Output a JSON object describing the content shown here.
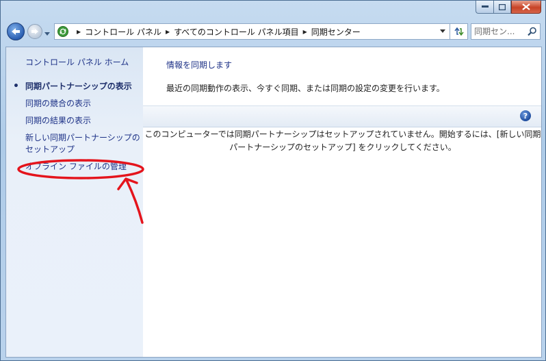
{
  "address": {
    "crumbs": [
      "コントロール パネル",
      "すべてのコントロール パネル項目",
      "同期センター"
    ],
    "search_placeholder": "同期セン..."
  },
  "sidebar": {
    "home": "コントロール パネル ホーム",
    "items": [
      {
        "label": "同期パートナーシップの表示",
        "active": true
      },
      {
        "label": "同期の競合の表示"
      },
      {
        "label": "同期の結果の表示"
      },
      {
        "label": "新しい同期パートナーシップのセットアップ"
      },
      {
        "label": "オフライン ファイルの管理"
      }
    ]
  },
  "main": {
    "title": "情報を同期します",
    "description": "最近の同期動作の表示、今すぐ同期、または同期の設定の変更を行います。",
    "message": "このコンピューターでは同期パートナーシップはセットアップされていません。開始するには、[新しい同期パートナーシップのセットアップ] をクリックしてください。"
  },
  "colors": {
    "link": "#1e3287",
    "annotation": "#e4141c"
  },
  "icons": [
    "back-icon",
    "forward-icon",
    "sync-center-icon",
    "refresh-icon",
    "search-icon",
    "help-icon",
    "minimize-icon",
    "maximize-icon",
    "close-icon"
  ]
}
